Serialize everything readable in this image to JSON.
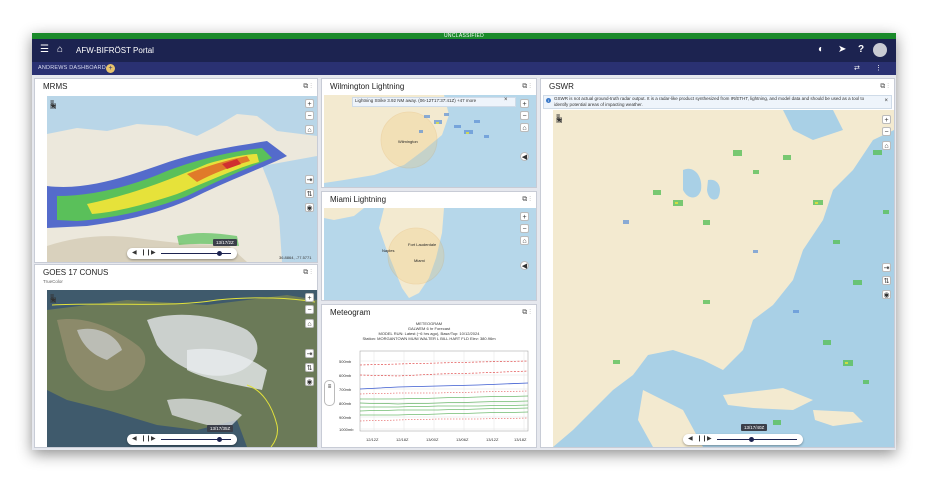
{
  "classification": "UNCLASSIFIED",
  "app": {
    "title": "AFW-BIFRÖST Portal",
    "menu_icon": "☰",
    "home_icon": "⌂"
  },
  "topbar_icons": {
    "contrast": "◐",
    "send": "➤",
    "help": "?"
  },
  "tabbar": {
    "active_tab": "ANDREWS DASHBOARD",
    "add": "+",
    "share": "⇄",
    "more": "⋮"
  },
  "panel_icons": {
    "popout": "⧉",
    "more": "⋮"
  },
  "mrms": {
    "title": "MRMS",
    "timestamp": "13/17/2Z",
    "coords": "36.8864, -77.5771"
  },
  "goes": {
    "title": "GOES 17 CONUS",
    "subtitle": "TrueColor",
    "timestamp": "13/17/35Z"
  },
  "wilmington": {
    "title": "Wilmington Lightning",
    "alert": "Lightning Strike 3.92 NM away. (06-12T17:37:41Z) +47 more",
    "city": "Wilmington"
  },
  "miami": {
    "title": "Miami Lightning",
    "cities": [
      "Fort Lauderdale",
      "Miami",
      "Naples"
    ]
  },
  "meteogram": {
    "title": "Meteogram",
    "header_lines": [
      "METEOGRAM",
      "GALWEM 6 hr Forecast",
      "MODEL RUN: Latest (~6 hrs ago), Base/Top: 10/12/2024",
      "Station: MORGANTOWN MUNI WALTER L BILL HART FLD Elev: 380.96m"
    ],
    "y_ticks": [
      "500mb",
      "600mb",
      "700mb",
      "800mb",
      "900mb",
      "1000mb"
    ],
    "x_ticks": [
      "12/12Z",
      "12/18Z",
      "13/00Z",
      "13/06Z",
      "13/12Z",
      "13/18Z"
    ]
  },
  "gswr": {
    "title": "GSWR",
    "notice": "GSWR is not actual ground-truth radar output. It is a radar-like product synthesized from IR/ETHT, lightning, and model data and should be used as a tool to identify potential areas of impacting weather.",
    "timestamp": "13/17/40Z"
  },
  "map_controls": {
    "zoom_in": "+",
    "zoom_out": "−",
    "home": "⌂",
    "layers": "≡",
    "star": "★",
    "legend": "▤",
    "draw": "✎",
    "login": "⇥",
    "transform": "⇅",
    "locate": "◉",
    "sound": "◀",
    "close": "×",
    "info": "i"
  },
  "slider_controls": {
    "prev": "◀",
    "play": "❙❙",
    "next": "▶"
  }
}
